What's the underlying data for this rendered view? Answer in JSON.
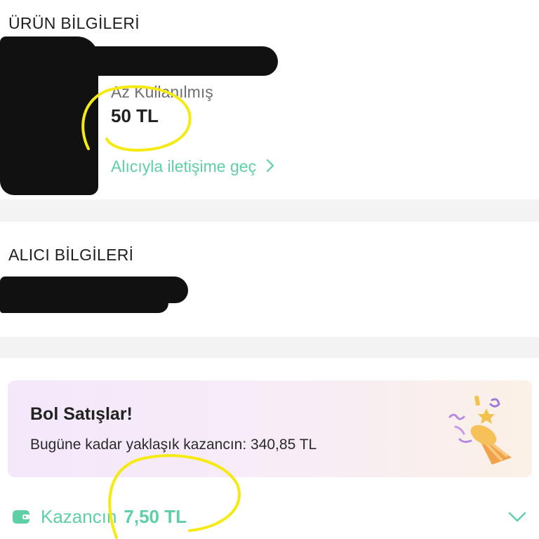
{
  "product": {
    "title": "ÜRÜN BİLGİLERİ",
    "condition": "Az Kullanılmış",
    "price": "50 TL",
    "contact_link": "Alıcıyla iletişime geç"
  },
  "buyer": {
    "title": "ALICI BİLGİLERİ"
  },
  "banner": {
    "title": "Bol Satışlar!",
    "subtitle": "Bugüne kadar yaklaşık kazancın: 340,85 TL"
  },
  "earnings": {
    "label": "Kazancın",
    "value": "7,50 TL"
  },
  "colors": {
    "accent": "#5fcfa5",
    "annotation": "#f5ea12",
    "redaction": "#111111"
  },
  "icons": [
    "chevron-right-icon",
    "party-popper-icon",
    "wallet-icon",
    "chevron-down-icon"
  ]
}
